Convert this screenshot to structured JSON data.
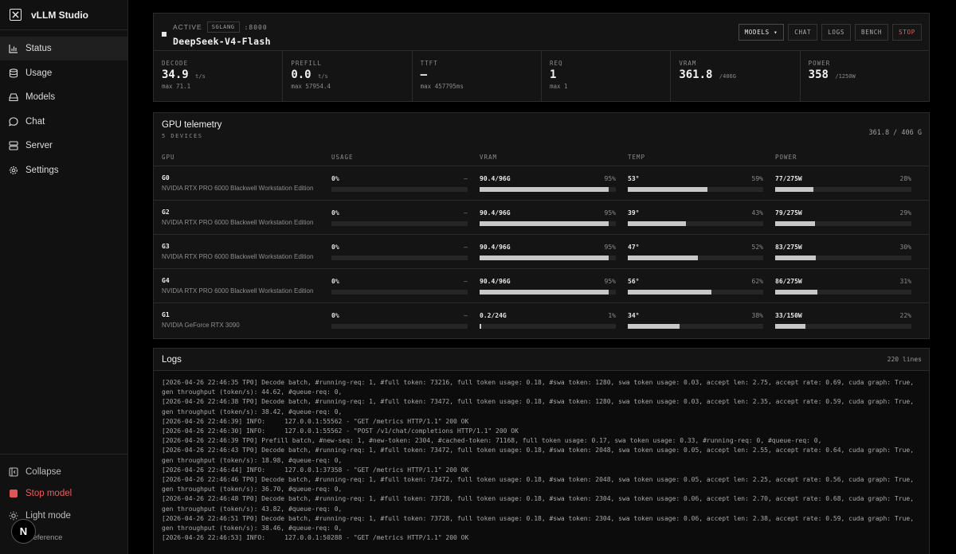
{
  "app": {
    "title": "vLLM Studio"
  },
  "sidebar": {
    "items": [
      {
        "label": "Status",
        "icon": "bar-chart-icon",
        "active": true
      },
      {
        "label": "Usage",
        "icon": "database-icon"
      },
      {
        "label": "Models",
        "icon": "hard-drive-icon"
      },
      {
        "label": "Chat",
        "icon": "chat-bubble-icon"
      },
      {
        "label": "Server",
        "icon": "server-icon"
      },
      {
        "label": "Settings",
        "icon": "gear-icon"
      }
    ],
    "bottom": {
      "collapse": "Collapse",
      "stop_model": "Stop model",
      "light_mode": "Light mode",
      "preference": "Preference"
    },
    "nx_badge": "N"
  },
  "header": {
    "status": "ACTIVE",
    "engine_badge": "SGLANG",
    "port": ":8000",
    "model_name": "DeepSeek-V4-Flash",
    "buttons": {
      "models": "MODELS ▾",
      "chat": "CHAT",
      "logs": "LOGS",
      "bench": "BENCH",
      "stop": "STOP"
    }
  },
  "metrics": [
    {
      "label": "DECODE",
      "value": "34.9",
      "unit": "t/s",
      "sub": "max 71.1"
    },
    {
      "label": "PREFILL",
      "value": "0.0",
      "unit": "t/s",
      "sub": "max 57954.4"
    },
    {
      "label": "TTFT",
      "value": "—",
      "unit": "",
      "sub": "max 457795ms"
    },
    {
      "label": "REQ",
      "value": "1",
      "unit": "",
      "sub": "max 1"
    },
    {
      "label": "VRAM",
      "value": "361.8",
      "unit": "/406G",
      "sub": ""
    },
    {
      "label": "POWER",
      "value": "358",
      "unit": "/1250W",
      "sub": ""
    }
  ],
  "gpu": {
    "title": "GPU telemetry",
    "subtitle": "5 DEVICES",
    "total": "361.8 / 406 G",
    "columns": [
      "GPU",
      "USAGE",
      "VRAM",
      "TEMP",
      "POWER"
    ],
    "rows": [
      {
        "id": "G0",
        "name": "NVIDIA RTX PRO 6000 Blackwell Workstation Edition",
        "usage": "0%",
        "usage_pct": "—",
        "usage_fill": 0,
        "vram": "90.4/96G",
        "vram_pct": "95%",
        "vram_fill": 95,
        "temp": "53°",
        "temp_pct": "59%",
        "temp_fill": 59,
        "power": "77/275W",
        "power_pct": "28%",
        "power_fill": 28
      },
      {
        "id": "G2",
        "name": "NVIDIA RTX PRO 6000 Blackwell Workstation Edition",
        "usage": "0%",
        "usage_pct": "—",
        "usage_fill": 0,
        "vram": "90.4/96G",
        "vram_pct": "95%",
        "vram_fill": 95,
        "temp": "39°",
        "temp_pct": "43%",
        "temp_fill": 43,
        "power": "79/275W",
        "power_pct": "29%",
        "power_fill": 29
      },
      {
        "id": "G3",
        "name": "NVIDIA RTX PRO 6000 Blackwell Workstation Edition",
        "usage": "0%",
        "usage_pct": "—",
        "usage_fill": 0,
        "vram": "90.4/96G",
        "vram_pct": "95%",
        "vram_fill": 95,
        "temp": "47°",
        "temp_pct": "52%",
        "temp_fill": 52,
        "power": "83/275W",
        "power_pct": "30%",
        "power_fill": 30
      },
      {
        "id": "G4",
        "name": "NVIDIA RTX PRO 6000 Blackwell Workstation Edition",
        "usage": "0%",
        "usage_pct": "—",
        "usage_fill": 0,
        "vram": "90.4/96G",
        "vram_pct": "95%",
        "vram_fill": 95,
        "temp": "56°",
        "temp_pct": "62%",
        "temp_fill": 62,
        "power": "86/275W",
        "power_pct": "31%",
        "power_fill": 31
      },
      {
        "id": "G1",
        "name": "NVIDIA GeForce RTX 3090",
        "usage": "0%",
        "usage_pct": "—",
        "usage_fill": 0,
        "vram": "0.2/24G",
        "vram_pct": "1%",
        "vram_fill": 1,
        "temp": "34°",
        "temp_pct": "38%",
        "temp_fill": 38,
        "power": "33/150W",
        "power_pct": "22%",
        "power_fill": 22
      }
    ]
  },
  "logs": {
    "title": "Logs",
    "count": "220 lines",
    "lines": [
      "[2026-04-26 22:46:35 TP0] Decode batch, #running-req: 1, #full token: 73216, full token usage: 0.18, #swa token: 1280, swa token usage: 0.03, accept len: 2.75, accept rate: 0.69, cuda graph: True, gen throughput (token/s): 44.62, #queue-req: 0,",
      "[2026-04-26 22:46:38 TP0] Decode batch, #running-req: 1, #full token: 73472, full token usage: 0.18, #swa token: 1280, swa token usage: 0.03, accept len: 2.35, accept rate: 0.59, cuda graph: True, gen throughput (token/s): 38.42, #queue-req: 0,",
      "[2026-04-26 22:46:39] INFO:     127.0.0.1:55562 - \"GET /metrics HTTP/1.1\" 200 OK",
      "[2026-04-26 22:46:30] INFO:     127.0.0.1:55562 - \"POST /v1/chat/completions HTTP/1.1\" 200 OK",
      "[2026-04-26 22:46:39 TP0] Prefill batch, #new-seq: 1, #new-token: 2304, #cached-token: 71168, full token usage: 0.17, swa token usage: 0.33, #running-req: 0, #queue-req: 0,",
      "[2026-04-26 22:46:43 TP0] Decode batch, #running-req: 1, #full token: 73472, full token usage: 0.18, #swa token: 2048, swa token usage: 0.05, accept len: 2.55, accept rate: 0.64, cuda graph: True, gen throughput (token/s): 18.98, #queue-req: 0,",
      "[2026-04-26 22:46:44] INFO:     127.0.0.1:37358 - \"GET /metrics HTTP/1.1\" 200 OK",
      "[2026-04-26 22:46:46 TP0] Decode batch, #running-req: 1, #full token: 73472, full token usage: 0.18, #swa token: 2048, swa token usage: 0.05, accept len: 2.25, accept rate: 0.56, cuda graph: True, gen throughput (token/s): 36.70, #queue-req: 0,",
      "[2026-04-26 22:46:48 TP0] Decode batch, #running-req: 1, #full token: 73728, full token usage: 0.18, #swa token: 2304, swa token usage: 0.06, accept len: 2.70, accept rate: 0.68, cuda graph: True, gen throughput (token/s): 43.82, #queue-req: 0,",
      "[2026-04-26 22:46:51 TP0] Decode batch, #running-req: 1, #full token: 73728, full token usage: 0.18, #swa token: 2304, swa token usage: 0.06, accept len: 2.38, accept rate: 0.59, cuda graph: True, gen throughput (token/s): 38.46, #queue-req: 0,",
      "[2026-04-26 22:46:53] INFO:     127.0.0.1:50288 - \"GET /metrics HTTP/1.1\" 200 OK"
    ]
  },
  "colors": {
    "accent_danger": "#e05555",
    "bar_fill": "#c8c8c8",
    "bar_track": "#262626"
  }
}
